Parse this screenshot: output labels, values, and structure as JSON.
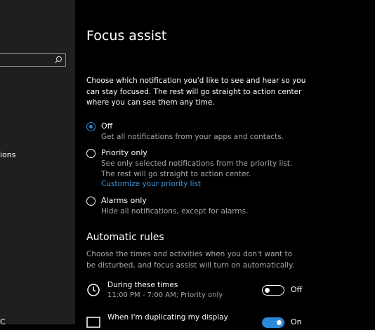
{
  "sidebar": {
    "search_placeholder": "",
    "fragment_1": "ions",
    "fragment_2": "C"
  },
  "page": {
    "title": "Focus assist",
    "description": "Choose which notification you'd like to see and hear so you can stay focused. The rest will go straight to action center where you can see them any time."
  },
  "options": [
    {
      "label": "Off",
      "description": "Get all notifications from your apps and contacts.",
      "selected": true
    },
    {
      "label": "Priority only",
      "description": "See only selected notifications from the priority list. The rest will go straight to action center.",
      "link": "Customize your priority list",
      "selected": false
    },
    {
      "label": "Alarms only",
      "description": "Hide all notifications, except for alarms.",
      "selected": false
    }
  ],
  "automatic_rules": {
    "heading": "Automatic rules",
    "description": "Choose the times and activities when you don't want to be disturbed, and focus assist will turn on automatically.",
    "rules": [
      {
        "icon": "clock-icon",
        "title": "During these times",
        "subtitle": "11:00 PM - 7:00 AM; Priority only",
        "state": "Off",
        "on": false
      },
      {
        "icon": "display-icon",
        "title": "When I'm duplicating my display",
        "subtitle": "",
        "state": "On",
        "on": true
      }
    ]
  },
  "colors": {
    "accent": "#2b88d8",
    "link": "#3a96dd",
    "sidebar_bg": "#1f1f1f",
    "main_bg": "#000000"
  }
}
